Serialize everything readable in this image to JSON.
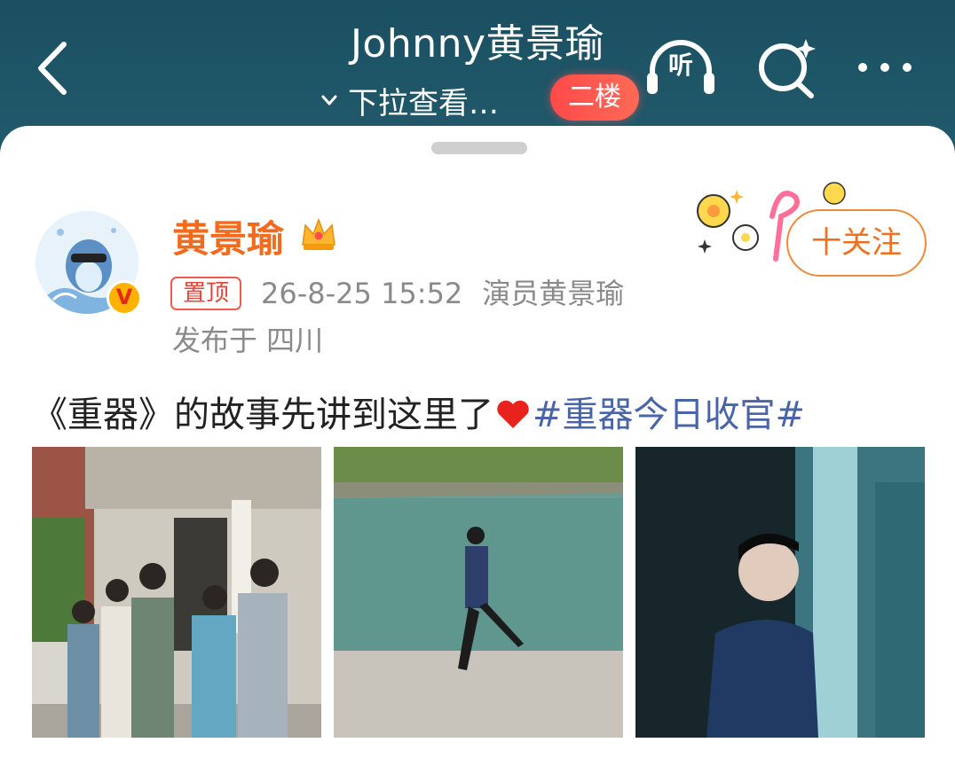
{
  "header": {
    "title": "Johnny黄景瑜",
    "subtitle": "下拉查看…",
    "floor_badge": "二楼",
    "listen_label": "听"
  },
  "post": {
    "author": {
      "name": "黄景瑜",
      "verified_label": "V"
    },
    "pinned_label": "置顶",
    "timestamp": "26-8-25 15:52",
    "source": "演员黄景瑜",
    "location": "发布于 四川",
    "follow_label": "十关注",
    "text_before": "《重器》的故事先讲到这里了",
    "hashtag": "#重器今日收官#",
    "images": [
      {
        "description": "cast-group-photo"
      },
      {
        "description": "man-running-by-lake"
      },
      {
        "description": "man-by-window"
      }
    ]
  },
  "colors": {
    "header_bg": "#1f5566",
    "username": "#f26b1d",
    "hashtag": "#4a64a8",
    "pin": "#e4463a",
    "follow": "#f07020",
    "floor_badge": "#ff4a4a"
  },
  "icons": [
    "back-arrow-icon",
    "chevron-down-icon",
    "headphones-icon",
    "search-sparkle-icon",
    "more-dots-icon",
    "crown-icon",
    "verified-icon",
    "heart-icon"
  ]
}
